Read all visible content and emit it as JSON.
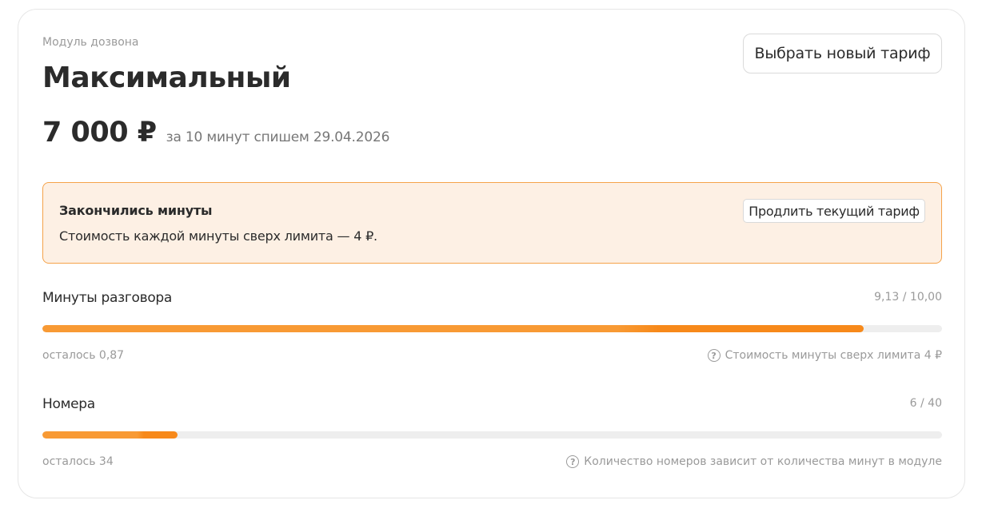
{
  "module": {
    "label": "Модуль дозвона",
    "tariff_name": "Максимальный",
    "price": "7 000 ₽",
    "price_note": "за 10 минут спишем 29.04.2026",
    "choose_button": "Выбрать новый тариф"
  },
  "alert": {
    "title": "Закончились минуты",
    "text": "Стоимость каждой минуты сверх лимита — 4 ₽.",
    "extend_button": "Продлить текущий тариф",
    "background_color": "#fdf0e4",
    "border_color": "#f5a34a"
  },
  "usage": [
    {
      "title": "Минуты разговора",
      "count": "9,13 / 10,00",
      "progress": 0.913,
      "left": "осталось 0,87",
      "hint": "Стоимость минуты сверх лимита 4 ₽",
      "icon": "question-icon"
    },
    {
      "title": "Номера",
      "count": "6 / 40",
      "progress": 0.15,
      "left": "осталось 34",
      "hint": "Количество номеров зависит от количества минут в модуле",
      "icon": "question-icon"
    }
  ],
  "colors": {
    "accent": "#f7891a",
    "track": "#eeeeee"
  }
}
